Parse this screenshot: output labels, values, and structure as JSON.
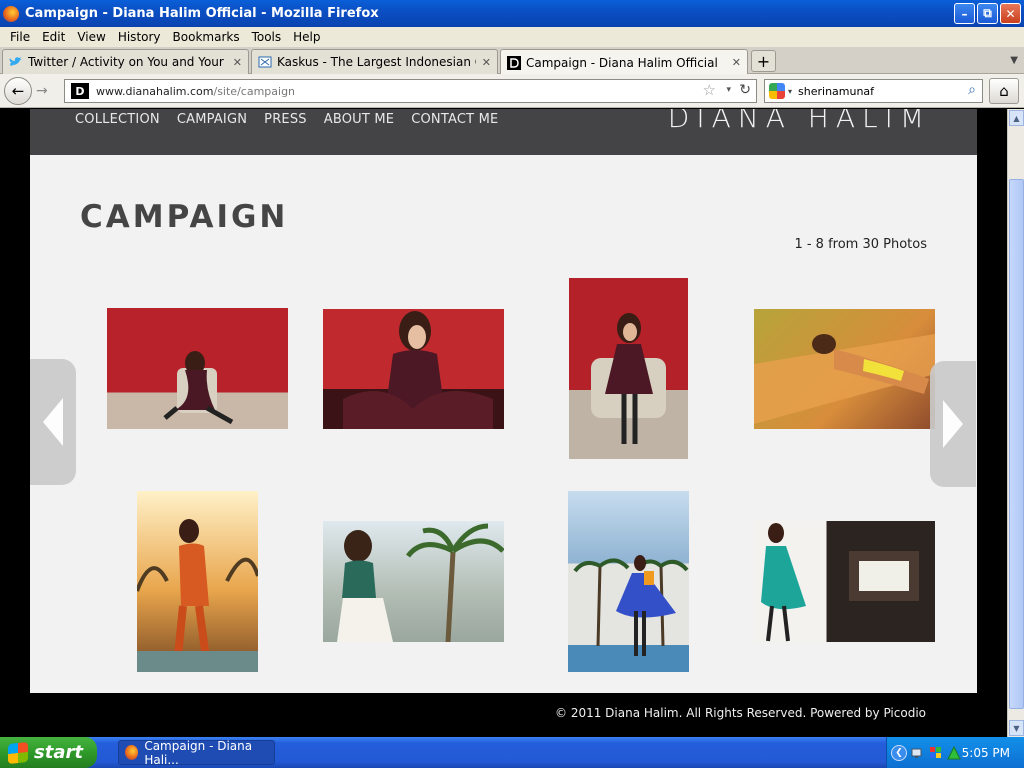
{
  "window": {
    "title": "Campaign - Diana Halim Official - Mozilla Firefox",
    "controls": {
      "minimize": "–",
      "maximize": "⧉",
      "close": "✕"
    }
  },
  "menu": [
    "File",
    "Edit",
    "View",
    "History",
    "Bookmarks",
    "Tools",
    "Help"
  ],
  "tabs": [
    {
      "label": "Twitter / Activity on You and Your Tweets",
      "icon": "twitter-icon",
      "active": false
    },
    {
      "label": "Kaskus - The Largest Indonesian Commu...",
      "icon": "kaskus-icon",
      "active": false
    },
    {
      "label": "Campaign - Diana Halim Official",
      "icon": "site-icon",
      "active": true
    }
  ],
  "tab_close": "✕",
  "new_tab": "+",
  "nav": {
    "back": "←",
    "forward": "→",
    "site_icon_letter": "D",
    "url_domain": "www.dianahalim.com",
    "url_path": "/site/campaign",
    "star": "☆",
    "dropdown": "▾",
    "reload": "↻",
    "search_engine_dropdown": "▾",
    "search_query": "sherinamunaf",
    "search_icon": "⌕",
    "home": "⌂"
  },
  "site": {
    "nav_items": [
      "COLLECTION",
      "CAMPAIGN",
      "PRESS",
      "ABOUT ME",
      "CONTACT ME"
    ],
    "logo": "DIANA HALIM",
    "heading": "CAMPAIGN",
    "photo_count": "1 - 8 from 30 Photos",
    "footer": "© 2011 Diana Halim. All Rights Reserved. Powered by Picodio",
    "photos": [
      {
        "name": "campaign-photo-1",
        "bg": "#b8222a"
      },
      {
        "name": "campaign-photo-2",
        "bg": "#c02a2f"
      },
      {
        "name": "campaign-photo-3",
        "bg": "#b52128"
      },
      {
        "name": "campaign-photo-4",
        "bg": "#c99a3a"
      },
      {
        "name": "campaign-photo-5",
        "bg": "#e3a24a"
      },
      {
        "name": "campaign-photo-6",
        "bg": "#a9b8b4"
      },
      {
        "name": "campaign-photo-7",
        "bg": "#7ea7c9"
      },
      {
        "name": "campaign-photo-8",
        "bg": "#ded9d2"
      }
    ]
  },
  "scrollbar": {
    "up": "▲",
    "down": "▼"
  },
  "taskbar": {
    "start": "start",
    "task_label": "Campaign - Diana Hali...",
    "tray_chevron": "❮",
    "clock": "5:05 PM"
  }
}
